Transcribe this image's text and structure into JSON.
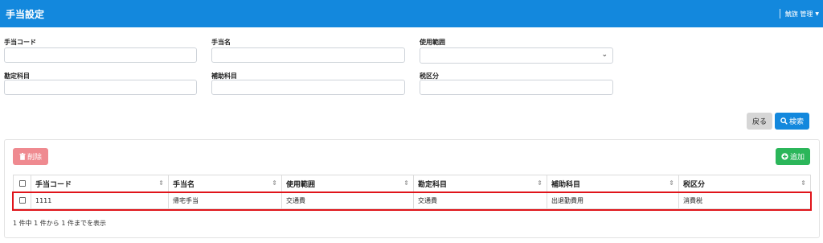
{
  "header": {
    "title": "手当設定",
    "user_menu": "鯱旗 管理"
  },
  "form": {
    "allowance_code_label": "手当コード",
    "allowance_name_label": "手当名",
    "usage_scope_label": "使用範囲",
    "account_label": "勘定科目",
    "sub_account_label": "補助科目",
    "tax_label": "税区分",
    "allowance_code_value": "",
    "allowance_name_value": "",
    "usage_scope_value": "",
    "account_value": "",
    "sub_account_value": "",
    "tax_value": ""
  },
  "buttons": {
    "back": "戻る",
    "search": "検索",
    "delete": "削除",
    "add": "追加"
  },
  "table": {
    "columns": [
      "手当コード",
      "手当名",
      "使用範囲",
      "勘定科目",
      "補助科目",
      "税区分"
    ],
    "rows": [
      [
        "1111",
        "帰宅手当",
        "交通費",
        "交通費",
        "出退勤費用",
        "消費税"
      ]
    ]
  },
  "footer": {
    "info": "1 件中 1 件から 1 件までを表示"
  },
  "colors": {
    "brand": "#1388dd",
    "delete": "#ef8a90",
    "add": "#2bb65a",
    "highlight": "#e0141a"
  }
}
